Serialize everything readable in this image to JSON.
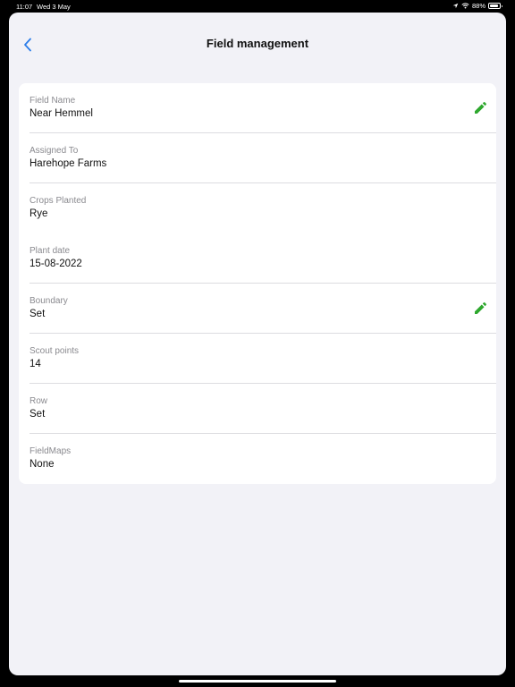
{
  "status_bar": {
    "time": "11:07",
    "date": "Wed 3 May",
    "battery": "88%",
    "battery_level": 0.88
  },
  "header": {
    "title": "Field management",
    "back_icon": "chevron-left-icon"
  },
  "colors": {
    "accent": "#2b7de9",
    "edit": "#2ea82e",
    "background": "#f2f2f7"
  },
  "fields": [
    {
      "label": "Field Name",
      "value": "Near Hemmel",
      "editable": true
    },
    {
      "label": "Assigned To",
      "value": "Harehope Farms",
      "editable": false
    },
    {
      "label": "Crops Planted",
      "value": "Rye",
      "editable": false
    },
    {
      "label": "Plant date",
      "value": "15-08-2022",
      "editable": false
    },
    {
      "label": "Boundary",
      "value": "Set",
      "editable": true
    },
    {
      "label": "Scout points",
      "value": "14",
      "editable": false
    },
    {
      "label": "Row",
      "value": "Set",
      "editable": false
    },
    {
      "label": "FieldMaps",
      "value": "None",
      "editable": false
    }
  ]
}
